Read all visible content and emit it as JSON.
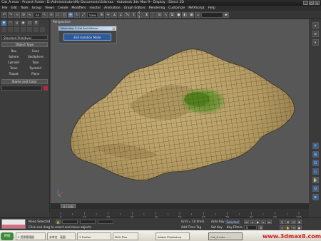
{
  "window": {
    "title": "Cat_A.max - Project Folder: D:\\Administrator\\My Documents\\3dsmax - Autodesk 3ds Max 9 - Display : Direct 3D"
  },
  "menu": [
    "File",
    "Edit",
    "Tools",
    "Group",
    "Views",
    "Create",
    "Modifiers",
    "reactor",
    "Animation",
    "Graph Editors",
    "Rendering",
    "Customize",
    "MAXScript",
    "Help"
  ],
  "toolbar": {
    "selection_filter": "All",
    "ref_coord": "View"
  },
  "command_panel": {
    "object_category": "Standard Primitives",
    "object_type_title": "Object Type",
    "buttons": [
      "Box",
      "Cone",
      "Sphere",
      "GeoSphere",
      "Cylinder",
      "Tube",
      "Torus",
      "Pyramid",
      "Teapot",
      "Plane"
    ],
    "name_color_title": "Name and Color"
  },
  "viewport": {
    "label": "Perspective"
  },
  "dialog": {
    "title": "Workshop 3 Cat ArchiVision",
    "button": "Exit Isolation Mode"
  },
  "timeline": {
    "frame_display": "0 / 100",
    "ticks": [
      "0",
      "10",
      "20",
      "30",
      "40",
      "50",
      "60",
      "70",
      "80",
      "90",
      "100"
    ]
  },
  "status": {
    "selection": "None Selected",
    "prompt": "Click and drag to select and move objects",
    "grid": "Grid = 10.0mm",
    "add_time_tag": "Add Time Tag",
    "auto_key": "Auto Key",
    "set_key": "Set Key",
    "selected": "Selected",
    "key_filters": "Key Filters...",
    "frame": "0"
  },
  "taskbar": {
    "start": "开始",
    "tasks": [
      "2 资源管理器",
      "未命名 - 画图",
      "3 Firefox",
      "MAX Plus",
      "Adobe Photoshop",
      "Cat_A.max - ..."
    ],
    "watermark": "www.3dmax8.com"
  },
  "colors": {
    "viewport_bg": "#575757",
    "accent_blue": "#2b5a9e",
    "terrain": "#b7a068",
    "mesh_green": "#5f8a2f"
  }
}
